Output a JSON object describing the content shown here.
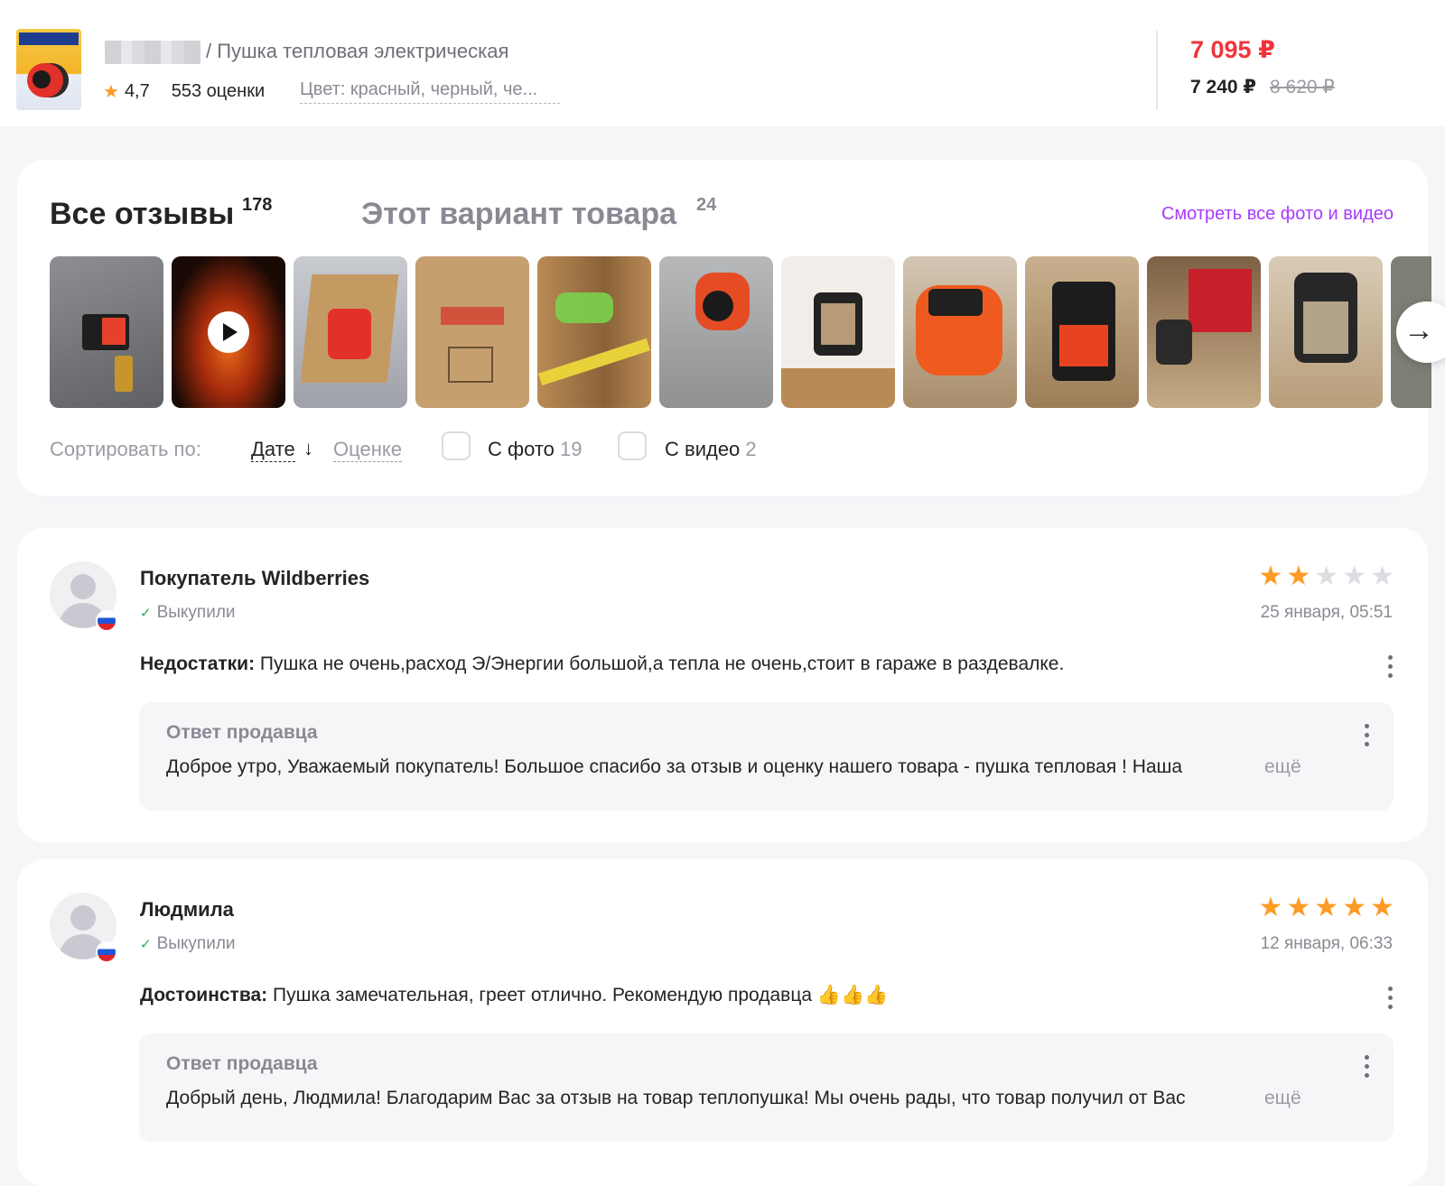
{
  "header": {
    "product_title": "/ Пушка тепловая электрическая",
    "rating": "4,7",
    "ratings_count": "553 оценки",
    "color_selector": "Цвет: красный, черный, че...",
    "price_current": "7 095 ₽",
    "price_wallet": "7 240 ₽",
    "price_old": "8 620 ₽"
  },
  "reviews_panel": {
    "tab_all": "Все отзывы",
    "tab_all_count": "178",
    "tab_variant": "Этот вариант товара",
    "tab_variant_count": "24",
    "see_all_link": "Смотреть все фото и видео",
    "sort_label": "Сортировать по:",
    "sort_date": "Дате",
    "sort_rating": "Оценке",
    "filter_photo": "С фото",
    "filter_photo_count": "19",
    "filter_video": "С видео",
    "filter_video_count": "2",
    "next_icon": "arrow-right-icon"
  },
  "reviews": [
    {
      "name": "Покупатель Wildberries",
      "status": "Выкупили",
      "rating": 2,
      "date": "25 января, 05:51",
      "text_label": "Недостатки:",
      "text": "Пушка не очень,расход Э/Энергии большой,а тепла не очень,стоит в гараже в раздевалке.",
      "answer_title": "Ответ продавца",
      "answer_text": "Доброе утро, Уважаемый покупатель! Большое спасибо за отзыв и оценку нашего товара - пушка тепловая ! Наша",
      "answer_more": "ещё"
    },
    {
      "name": "Людмила",
      "status": "Выкупили",
      "rating": 5,
      "date": "12 января, 06:33",
      "text_label": "Достоинства:",
      "text": "Пушка замечательная, греет отлично. Рекомендую продавца 👍👍👍",
      "answer_title": "Ответ продавца",
      "answer_text": "Добрый день, Людмила! Благодарим Вас за отзыв на товар теплопушка! Мы очень рады, что товар получил от Вас",
      "answer_more": "ещё"
    }
  ],
  "colors": {
    "accent": "#a73afd",
    "price": "#f0343c",
    "star": "#ff9a24",
    "check": "#22b14c"
  }
}
